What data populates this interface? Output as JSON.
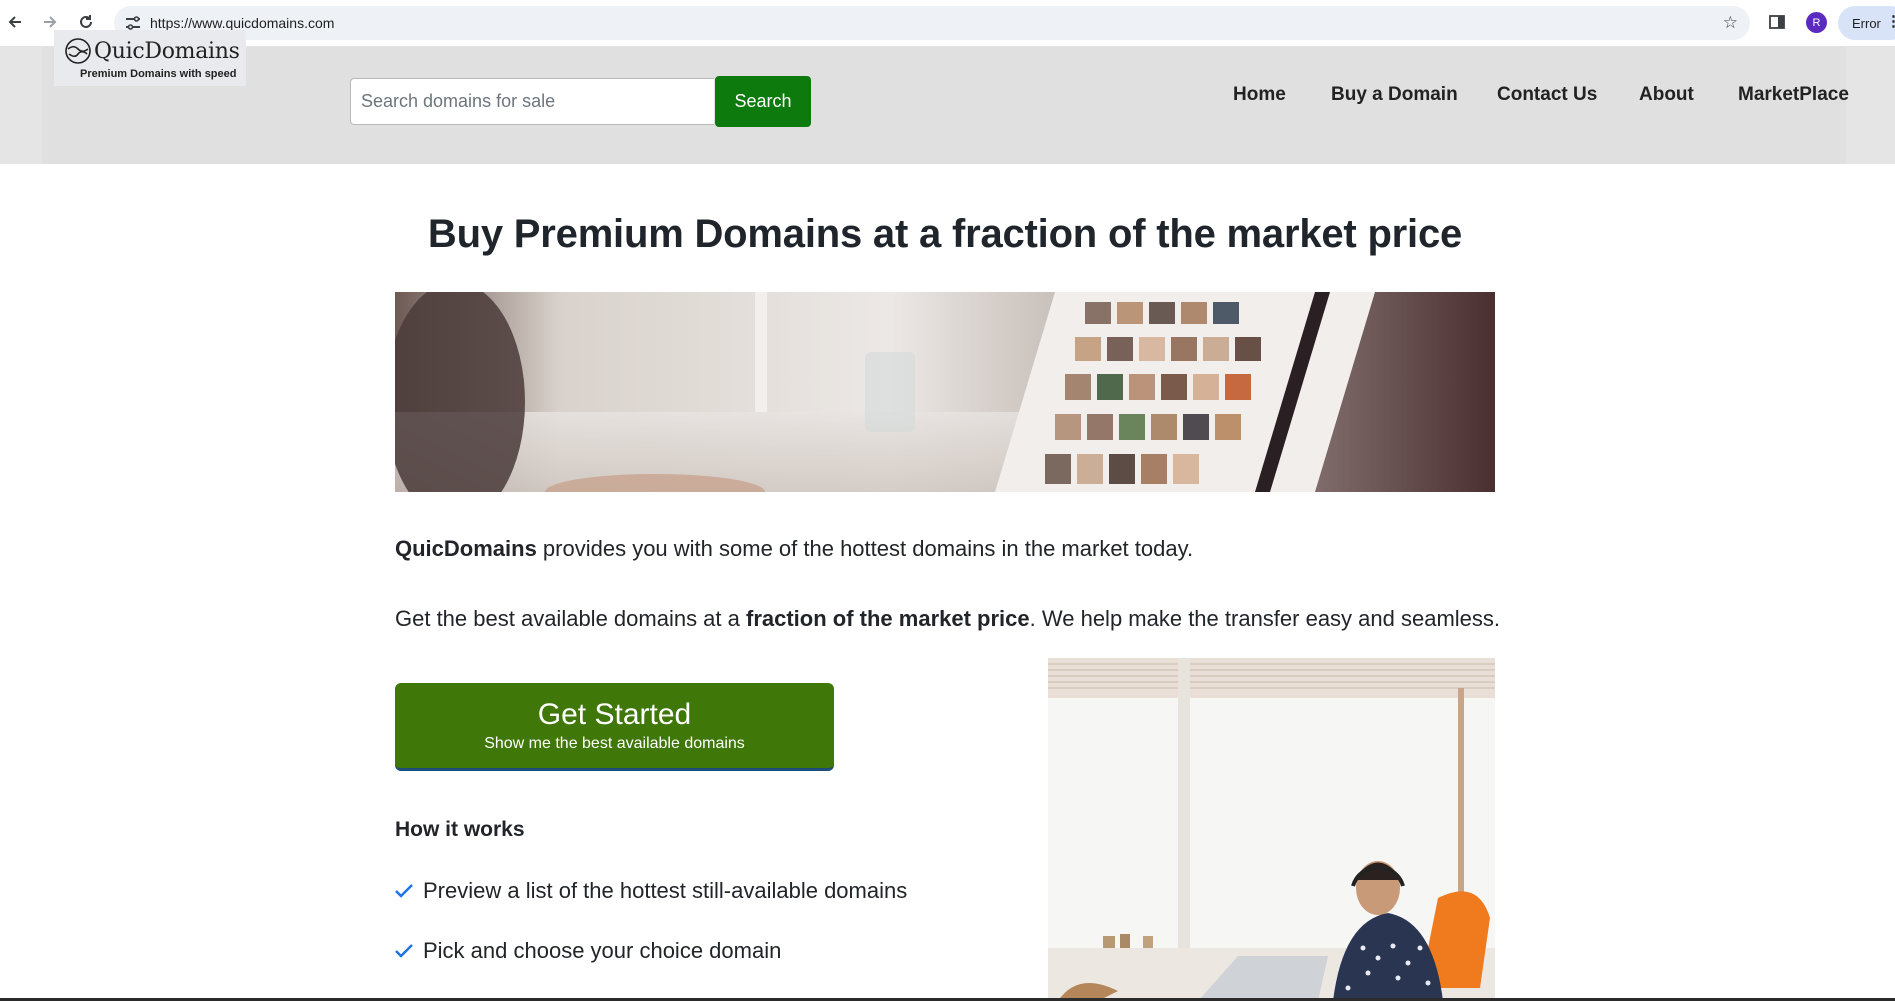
{
  "browser": {
    "url": "https://www.quicdomains.com",
    "profile_initial": "R",
    "error_label": "Error",
    "icons": [
      "back-icon",
      "forward-icon",
      "reload-icon",
      "site-settings-icon",
      "star-icon",
      "side-panel-icon",
      "menu-icon"
    ]
  },
  "header": {
    "logo": {
      "title": "QuicDomains",
      "tagline": "Premium Domains with speed"
    },
    "search": {
      "placeholder": "Search domains for sale",
      "value": "",
      "button": "Search"
    },
    "nav": [
      "Home",
      "Buy a Domain",
      "Contact Us",
      "About",
      "MarketPlace"
    ]
  },
  "main": {
    "title": "Buy Premium Domains at a fraction of the market price",
    "intro": {
      "brand": "QuicDomains",
      "rest": " provides you with some of the hottest domains in the market today."
    },
    "value_prop": {
      "before": "Get the best available domains at a ",
      "bold": "fraction of the market price",
      "after": ". We help make the transfer easy and seamless."
    },
    "cta": {
      "title": "Get Started",
      "subtitle": "Show me the best available domains"
    },
    "how_it_works": {
      "title": "How it works",
      "steps": [
        "Preview a list of the hottest still-available domains",
        "Pick and choose your choice domain"
      ]
    }
  },
  "colors": {
    "primary_button": "#0d7a0d",
    "cta": "#3f7708",
    "check": "#1a73e8",
    "header_bg": "#e0e0e0"
  }
}
